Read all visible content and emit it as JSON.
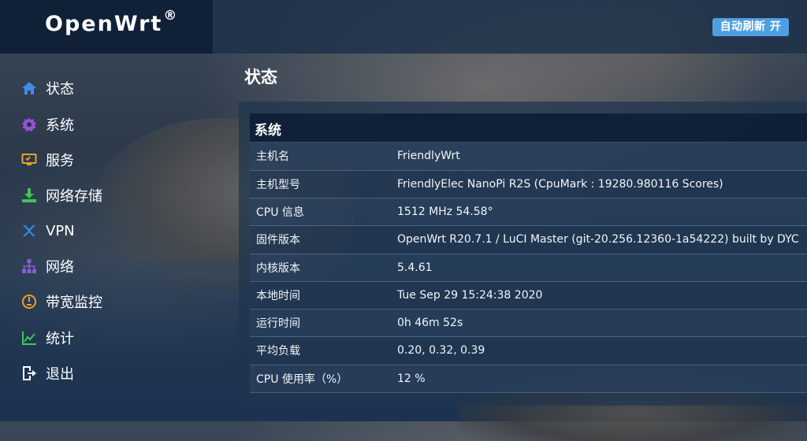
{
  "header": {
    "brand": "OpenWrt",
    "brand_mark": "®",
    "auto_refresh_label": "自动刷新 开"
  },
  "sidebar": {
    "items": [
      {
        "label": "状态",
        "icon": "home-icon",
        "color": "#3d8ee8"
      },
      {
        "label": "系统",
        "icon": "gear-icon",
        "color": "#9a4fd6"
      },
      {
        "label": "服务",
        "icon": "monitor-icon",
        "color": "#e8a12b"
      },
      {
        "label": "网络存储",
        "icon": "download-icon",
        "color": "#3fc55a"
      },
      {
        "label": "VPN",
        "icon": "vpn-icon",
        "color": "#2f8fe8"
      },
      {
        "label": "网络",
        "icon": "network-icon",
        "color": "#8b5cd6"
      },
      {
        "label": "带宽监控",
        "icon": "gauge-icon",
        "color": "#e8a12b"
      },
      {
        "label": "统计",
        "icon": "chart-icon",
        "color": "#3fc55a"
      },
      {
        "label": "退出",
        "icon": "logout-icon",
        "color": "#ffffff"
      }
    ]
  },
  "main": {
    "page_title": "状态",
    "section_title": "系统",
    "rows": [
      {
        "key": "主机名",
        "value": "FriendlyWrt"
      },
      {
        "key": "主机型号",
        "value": "FriendlyElec NanoPi R2S (CpuMark : 19280.980116 Scores)"
      },
      {
        "key": "CPU 信息",
        "value": "1512 MHz 54.58°"
      },
      {
        "key": "固件版本",
        "value": "OpenWrt R20.7.1 / LuCI Master (git-20.256.12360-1a54222) built by DYC"
      },
      {
        "key": "内核版本",
        "value": "5.4.61"
      },
      {
        "key": "本地时间",
        "value": "Tue Sep 29 15:24:38 2020"
      },
      {
        "key": "运行时间",
        "value": "0h 46m 52s"
      },
      {
        "key": "平均负载",
        "value": "0.20, 0.32, 0.39"
      },
      {
        "key": "CPU 使用率（%）",
        "value": "12 %"
      }
    ]
  }
}
